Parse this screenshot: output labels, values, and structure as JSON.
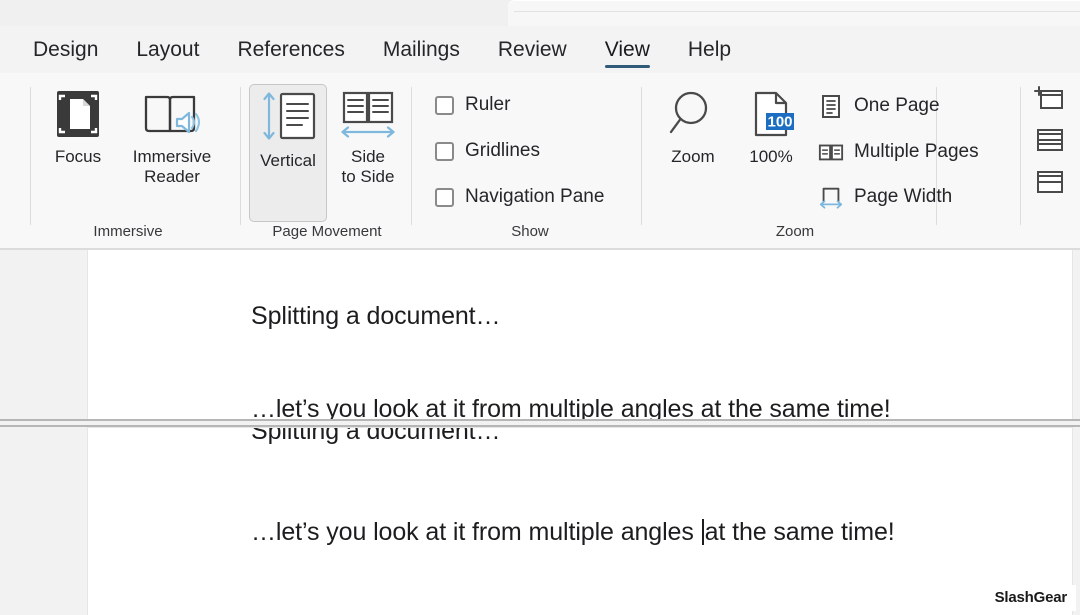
{
  "ribbon": {
    "tabs": [
      {
        "label": "Design",
        "active": false
      },
      {
        "label": "Layout",
        "active": false
      },
      {
        "label": "References",
        "active": false
      },
      {
        "label": "Mailings",
        "active": false
      },
      {
        "label": "Review",
        "active": false
      },
      {
        "label": "View",
        "active": true
      },
      {
        "label": "Help",
        "active": false
      }
    ],
    "active_tab": "View",
    "accent_color": "#2f5a78",
    "groups": {
      "immersive": {
        "label": "Immersive",
        "buttons": [
          {
            "label": "Focus",
            "icon": "focus-page-icon"
          },
          {
            "label": "Immersive\nReader",
            "icon": "book-speaker-icon"
          }
        ]
      },
      "page_movement": {
        "label": "Page Movement",
        "buttons": [
          {
            "label": "Vertical",
            "icon": "vertical-scroll-page-icon",
            "selected": true
          },
          {
            "label": "Side\nto Side",
            "icon": "side-to-side-book-icon",
            "selected": false
          }
        ]
      },
      "show": {
        "label": "Show",
        "checkboxes": [
          {
            "label": "Ruler",
            "checked": false
          },
          {
            "label": "Gridlines",
            "checked": false
          },
          {
            "label": "Navigation Pane",
            "checked": false
          }
        ]
      },
      "zoom": {
        "label": "Zoom",
        "buttons": [
          {
            "label": "Zoom",
            "icon": "magnifier-icon"
          },
          {
            "label": "100%",
            "icon": "page-percent-icon",
            "badge": "100",
            "badge_color": "#1b6ec2"
          }
        ],
        "items": [
          {
            "label": "One Page",
            "icon": "one-page-icon"
          },
          {
            "label": "Multiple Pages",
            "icon": "multiple-pages-icon"
          },
          {
            "label": "Page Width",
            "icon": "page-width-icon"
          }
        ]
      },
      "window": {
        "buttons": [
          {
            "icon": "new-window-icon"
          },
          {
            "icon": "arrange-all-icon"
          },
          {
            "icon": "split-window-icon"
          }
        ]
      }
    }
  },
  "document": {
    "top_pane": {
      "line1": "Splitting a document…",
      "line2": "…let’s you look at it from multiple angles at the same time!"
    },
    "bottom_pane": {
      "line1": "Splitting a document…",
      "line2_before_caret": "…let’s you look at it from multiple angles ",
      "line2_after_caret": "at the same time!"
    }
  },
  "watermark": {
    "text": "SlashGear"
  }
}
